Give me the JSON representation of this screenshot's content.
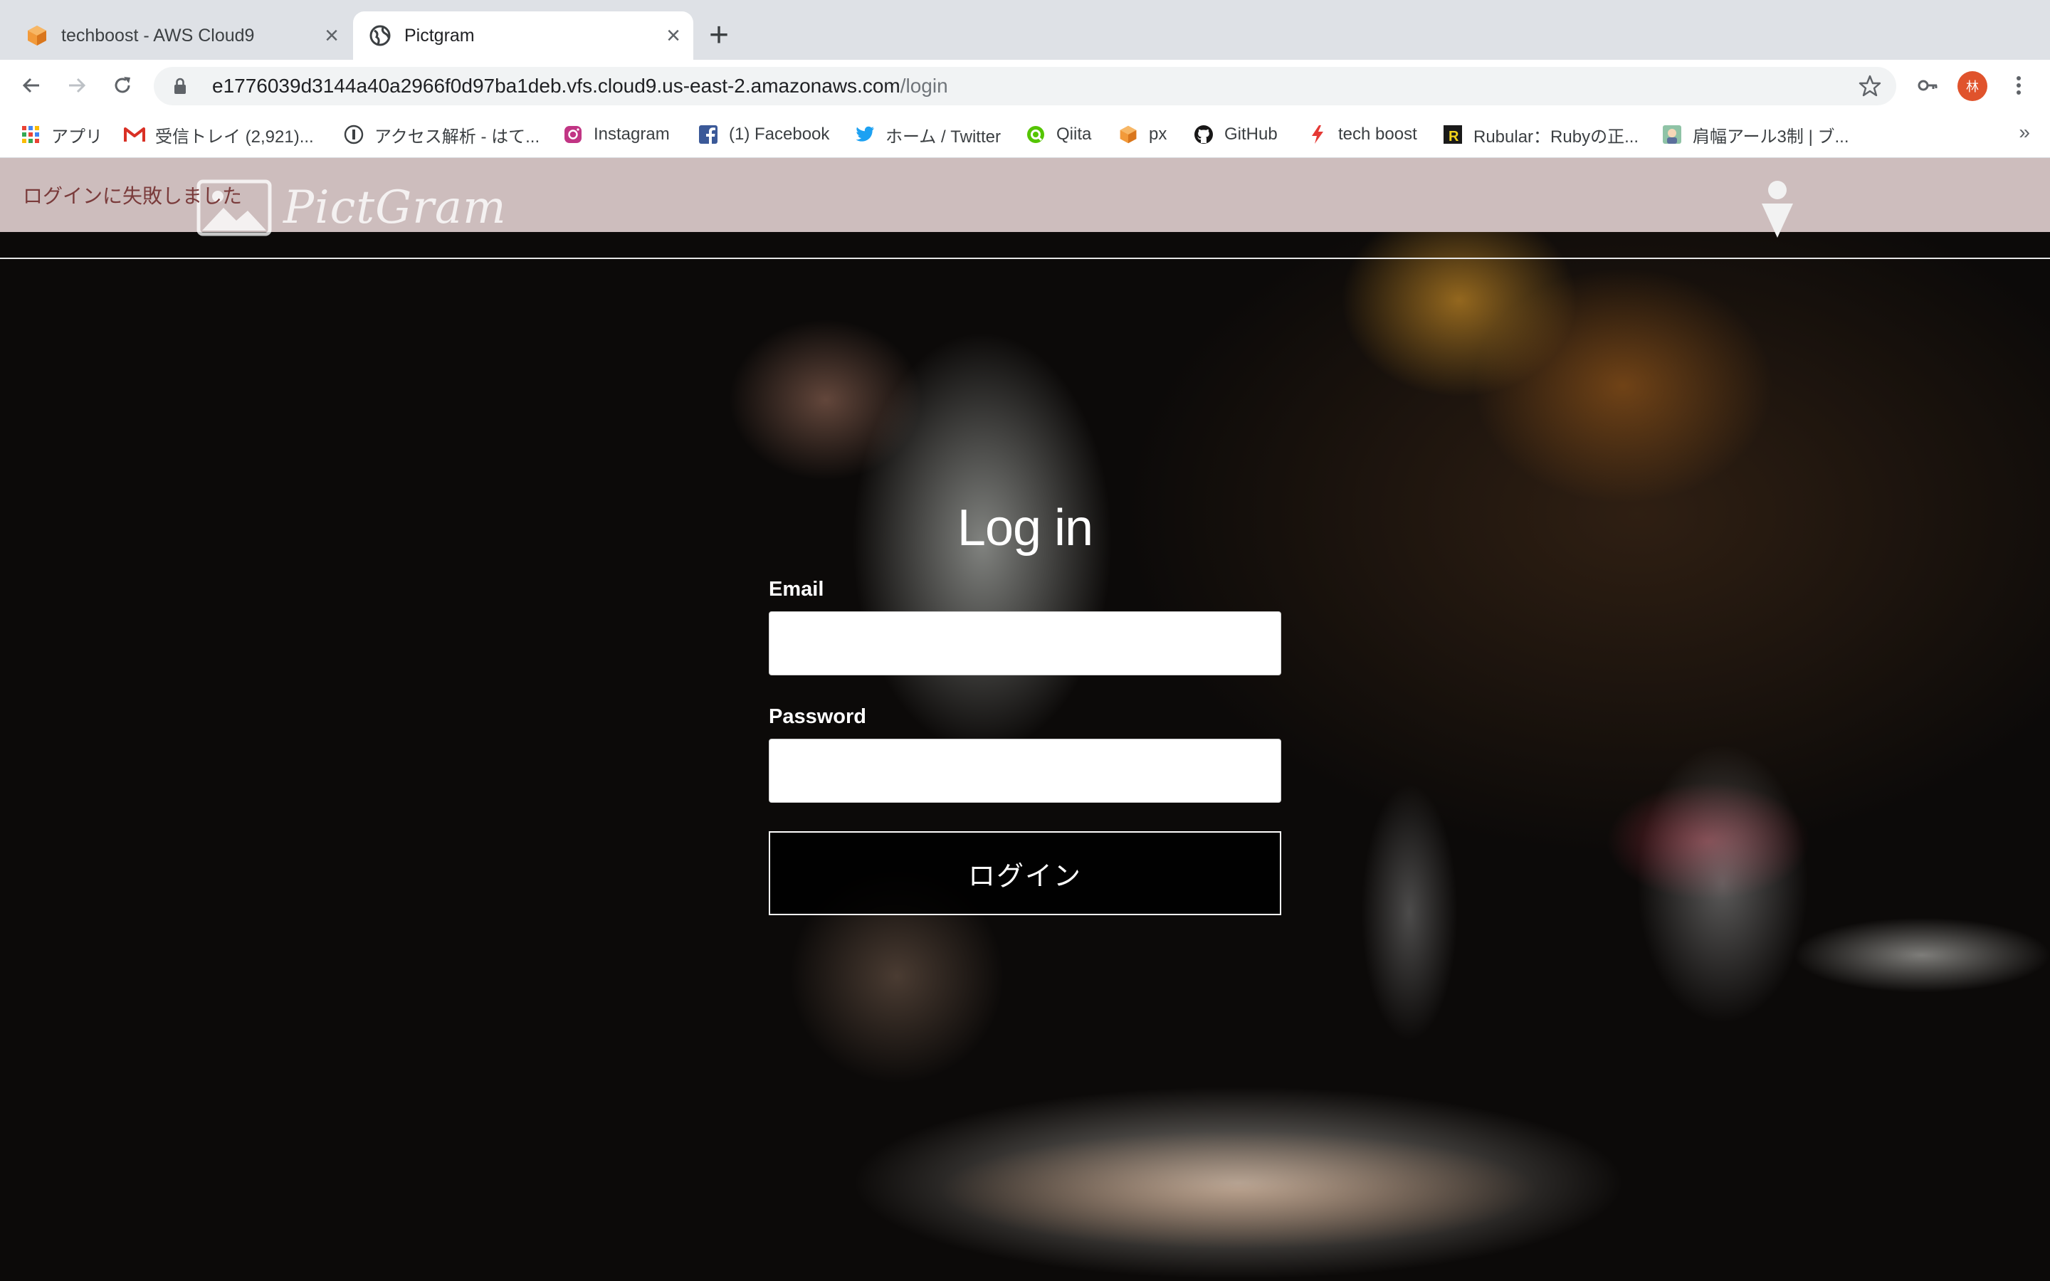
{
  "browser": {
    "tabs": [
      {
        "title": "techboost - AWS Cloud9",
        "favicon": "cloud9-cube-icon",
        "active": false
      },
      {
        "title": "Pictgram",
        "favicon": "globe-icon",
        "active": true
      }
    ],
    "new_tab_label": "+",
    "url_host": "e1776039d3144a40a2966f0d97ba1deb.vfs.cloud9.us-east-2.amazonaws.com",
    "url_path": "/login",
    "profile_initial": "林",
    "bookmarks": [
      {
        "label": "アプリ",
        "icon": "apps-grid-icon"
      },
      {
        "label": "受信トレイ (2,921)...",
        "icon": "gmail-icon"
      },
      {
        "label": "アクセス解析 - はて...",
        "icon": "hatena-icon"
      },
      {
        "label": "Instagram",
        "icon": "instagram-icon"
      },
      {
        "label": "(1) Facebook",
        "icon": "facebook-icon"
      },
      {
        "label": "ホーム / Twitter",
        "icon": "twitter-icon"
      },
      {
        "label": "Qiita",
        "icon": "qiita-icon"
      },
      {
        "label": "px",
        "icon": "cube-icon"
      },
      {
        "label": "GitHub",
        "icon": "github-icon"
      },
      {
        "label": "tech boost",
        "icon": "bolt-icon"
      },
      {
        "label": "Rubular：Rubyの正...",
        "icon": "rubular-icon"
      },
      {
        "label": "肩幅アール3制 | ブ...",
        "icon": "avatar-thumbnail-icon"
      }
    ],
    "bookmarks_overflow": "»"
  },
  "page": {
    "flash_message": "ログインに失敗しました",
    "brand": "PictGram",
    "login": {
      "title": "Log in",
      "email_label": "Email",
      "email_value": "",
      "password_label": "Password",
      "password_value": "",
      "submit_label": "ログイン"
    }
  },
  "colors": {
    "flash_bg": "#cdbdbd",
    "flash_text": "#7a3b3b",
    "avatar_bg": "#e0532c"
  }
}
